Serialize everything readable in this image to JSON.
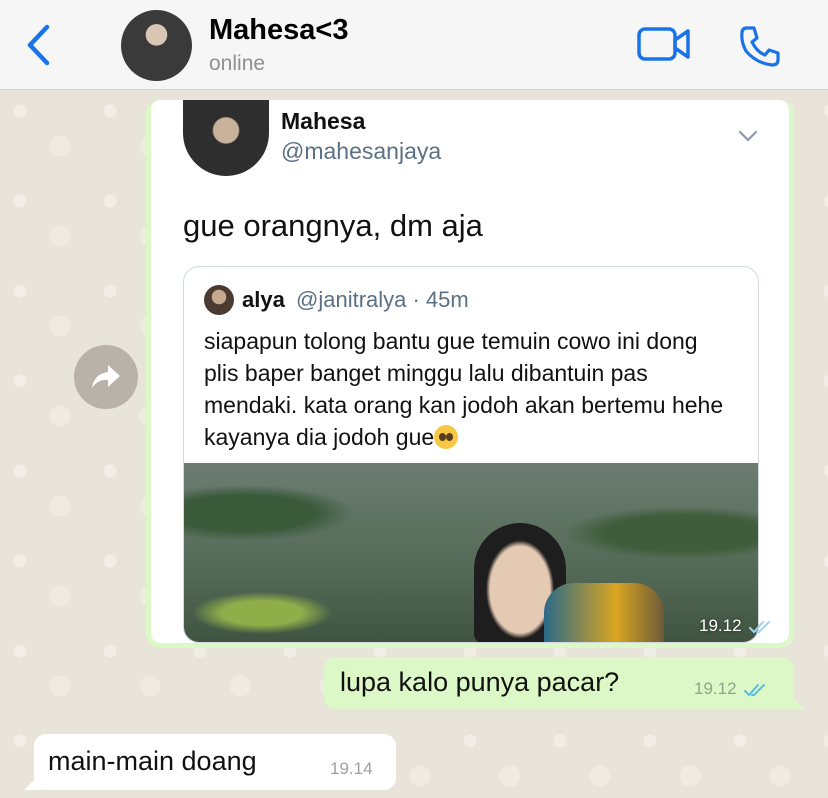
{
  "header": {
    "contact_name": "Mahesa<3",
    "status": "online",
    "accent_color": "#1a73e8"
  },
  "forwarded_image": {
    "tweet": {
      "name": "Mahesa",
      "handle": "@mahesanjaya",
      "text": "gue orangnya, dm aja",
      "quoted": {
        "name": "alya",
        "meta": "@janitralya · 45m",
        "text": "siapapun tolong bantu gue temuin cowo ini dong plis baper banget minggu lalu dibantuin pas mendaki. kata orang kan jodoh akan bertemu hehe kayanya dia jodoh gue",
        "emoji": "pleading-face"
      }
    },
    "time": "19.12"
  },
  "messages": [
    {
      "direction": "out",
      "text": "lupa kalo punya pacar?",
      "time": "19.12",
      "status": "read"
    },
    {
      "direction": "in",
      "text": "main-main doang",
      "time": "19.14"
    }
  ],
  "colors": {
    "outgoing_bubble": "#dcf8c6",
    "incoming_bubble": "#ffffff",
    "read_ticks": "#53bdeb",
    "chat_background": "#e9e4da"
  }
}
